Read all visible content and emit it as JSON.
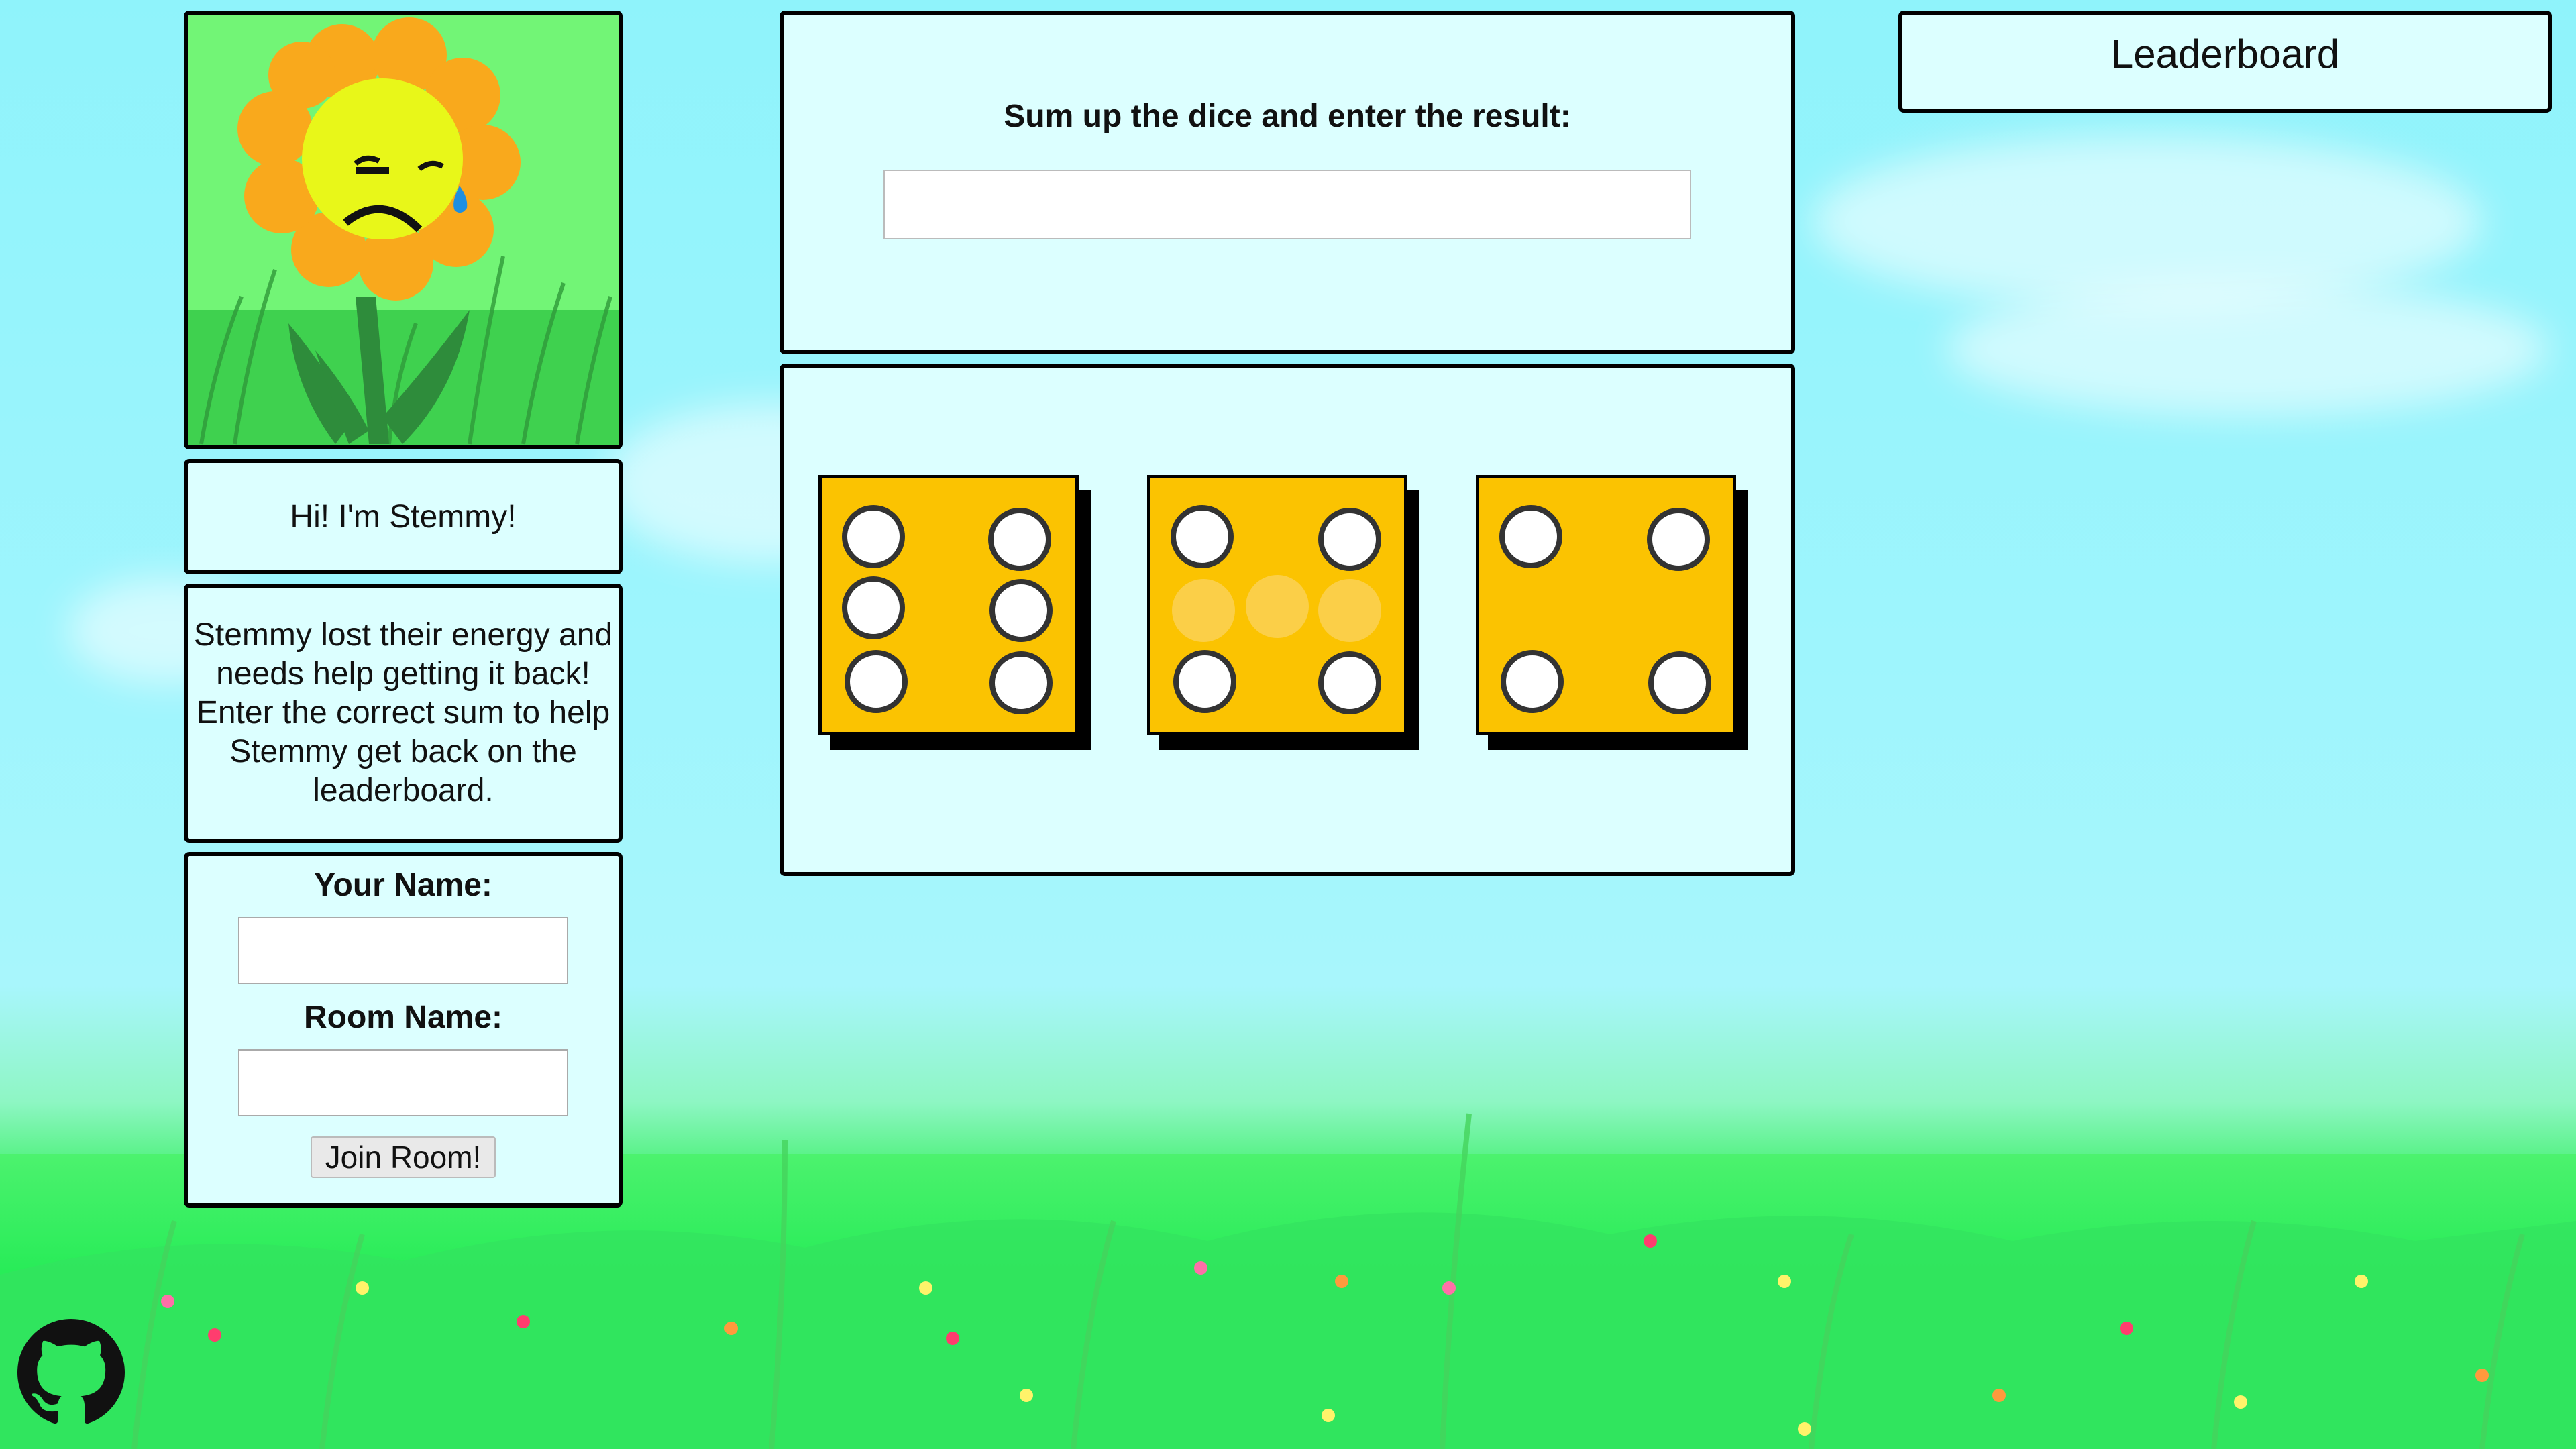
{
  "character": {
    "greeting": "Hi! I'm Stemmy!",
    "story": "Stemmy lost their energy and needs help getting it back! Enter the correct sum to help Stemmy get back on the leaderboard."
  },
  "join_form": {
    "name_label": "Your Name:",
    "name_value": "",
    "room_label": "Room Name:",
    "room_value": "",
    "join_label": "Join Room!"
  },
  "game": {
    "prompt": "Sum up the dice and enter the result:",
    "answer_value": "",
    "dice": [
      {
        "pips": 6,
        "visible_faces": 6
      },
      {
        "pips": 4,
        "visible_faces": 4,
        "faded_pips": 3
      },
      {
        "pips": 4,
        "visible_faces": 4
      }
    ]
  },
  "leaderboard": {
    "title": "Leaderboard"
  },
  "icons": {
    "portrait": "sad-flower-icon",
    "repo_link": "github-icon"
  },
  "colors": {
    "panel_bg": "#dcffff",
    "die_face": "#fbc301",
    "sky": "#9ef5fd",
    "grass": "#2ee85a"
  }
}
